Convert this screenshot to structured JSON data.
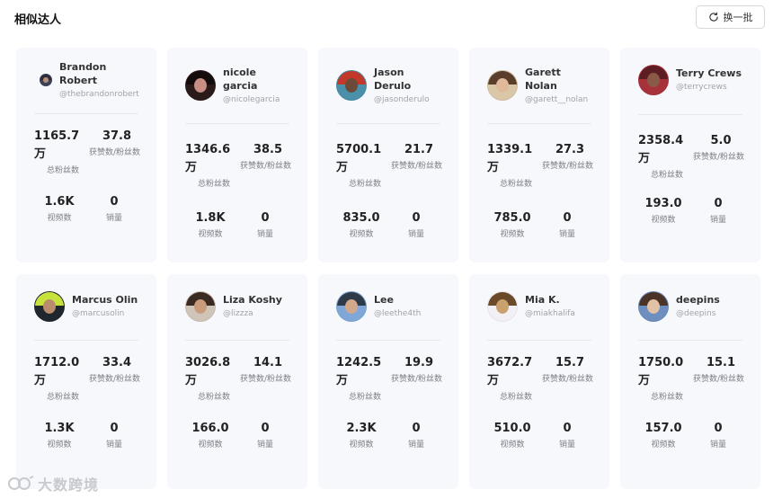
{
  "header": {
    "title": "相似达人",
    "refresh_label": "换一批"
  },
  "labels": {
    "followers": "总粉丝数",
    "likes_ratio": "获赞数/粉丝数",
    "videos": "视频数",
    "sales": "销量"
  },
  "watermark": "大数跨境",
  "colors": {
    "card_bg": "#f7f8fc",
    "muted_text": "#a0a3ab"
  },
  "cards": [
    {
      "name": "Brandon Robert",
      "handle": "@thebrandonrobert",
      "followers": "1165.7\n万",
      "likes_ratio": "37.8",
      "videos": "1.6K",
      "sales": "0",
      "avatar": {
        "bg": "#3c4358",
        "hair": "#2a2d3a",
        "face": "#b88e74"
      }
    },
    {
      "name": "nicole garcia",
      "handle": "@nicolegarcia",
      "followers": "1346.6\n万",
      "likes_ratio": "38.5",
      "videos": "1.8K",
      "sales": "0",
      "avatar": {
        "bg": "#2a1a1a",
        "hair": "#140c0c",
        "face": "#c98e83"
      }
    },
    {
      "name": "Jason Derulo",
      "handle": "@jasonderulo",
      "followers": "5700.1\n万",
      "likes_ratio": "21.7",
      "videos": "835.0",
      "sales": "0",
      "avatar": {
        "bg": "#4a90a8",
        "hair": "#c0392b",
        "face": "#6b4a3a"
      }
    },
    {
      "name": "Garett Nolan",
      "handle": "@garett__nolan",
      "followers": "1339.1\n万",
      "likes_ratio": "27.3",
      "videos": "785.0",
      "sales": "0",
      "avatar": {
        "bg": "#d9c7a8",
        "hair": "#5a3e2b",
        "face": "#e0b89a"
      }
    },
    {
      "name": "Terry Crews",
      "handle": "@terrycrews",
      "followers": "2358.4\n万",
      "likes_ratio": "5.0",
      "videos": "193.0",
      "sales": "0",
      "avatar": {
        "bg": "#a8323a",
        "hair": "#5c1e22",
        "face": "#8a5a48"
      }
    },
    {
      "name": "Marcus Olin",
      "handle": "@marcusolin",
      "followers": "1712.0\n万",
      "likes_ratio": "33.4",
      "videos": "1.3K",
      "sales": "0",
      "avatar": {
        "bg": "#20262e",
        "hair": "#c7e23a",
        "face": "#b98c6e"
      }
    },
    {
      "name": "Liza Koshy",
      "handle": "@lizzza",
      "followers": "3026.8\n万",
      "likes_ratio": "14.1",
      "videos": "166.0",
      "sales": "0",
      "avatar": {
        "bg": "#cfc4b8",
        "hair": "#3a2a22",
        "face": "#c99b7d"
      }
    },
    {
      "name": "Lee",
      "handle": "@leethe4th",
      "followers": "1242.5\n万",
      "likes_ratio": "19.9",
      "videos": "2.3K",
      "sales": "0",
      "avatar": {
        "bg": "#7fa7d8",
        "hair": "#2f3a48",
        "face": "#d2a88c"
      }
    },
    {
      "name": "Mia K.",
      "handle": "@miakhalifa",
      "followers": "3672.7\n万",
      "likes_ratio": "15.7",
      "videos": "510.0",
      "sales": "0",
      "avatar": {
        "bg": "#f2f0f4",
        "hair": "#6b4a2a",
        "face": "#c9a06e"
      }
    },
    {
      "name": "deepins",
      "handle": "@deepins",
      "followers": "1750.0\n万",
      "likes_ratio": "15.1",
      "videos": "157.0",
      "sales": "0",
      "avatar": {
        "bg": "#6d8ebf",
        "hair": "#4a3426",
        "face": "#e2c2a6"
      }
    }
  ]
}
